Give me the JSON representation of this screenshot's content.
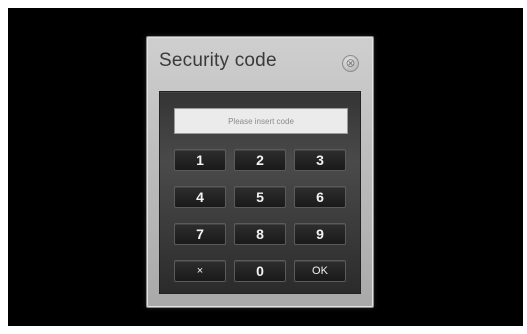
{
  "dialog": {
    "title": "Security code",
    "close_icon": "close-circle-icon",
    "close_glyph": "⊗"
  },
  "code_input": {
    "value": "",
    "placeholder": "Please insert code"
  },
  "keypad": {
    "keys": [
      "1",
      "2",
      "3",
      "4",
      "5",
      "6",
      "7",
      "8",
      "9",
      "×",
      "0",
      "OK"
    ]
  }
}
